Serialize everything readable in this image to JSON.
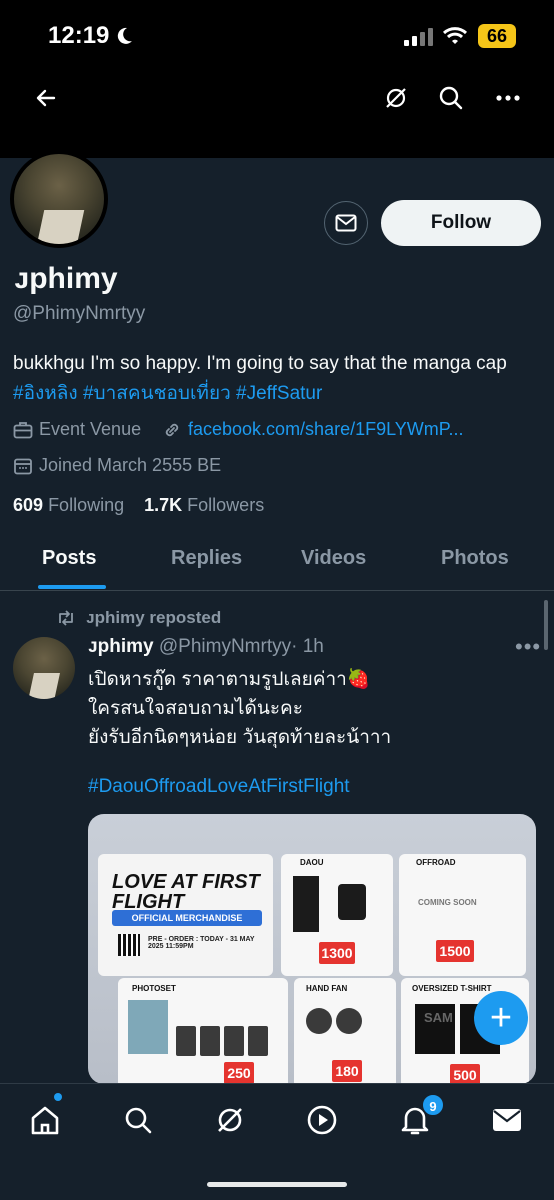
{
  "status_bar": {
    "time": "12:19",
    "battery": "66"
  },
  "profile": {
    "display_name": "ᴊphimy",
    "handle": "@PhimyNmrtyy",
    "bio_text": "bukkhgu I'm so happy. I'm going to say that the manga cap ",
    "bio_tags": [
      "#อิงหลิง",
      "#บาสคนชอบเที่ยว",
      "#JeffSatur"
    ],
    "category": "Event Venue",
    "link": "facebook.com/share/1F9LYWmP...",
    "joined": "Joined March 2555 BE",
    "following_count": "609",
    "following_label": "Following",
    "followers_count": "1.7K",
    "followers_label": "Followers",
    "follow_label": "Follow"
  },
  "tabs": [
    "Posts",
    "Replies",
    "Videos",
    "Photos"
  ],
  "post": {
    "repost_label": "ᴊphimy reposted",
    "author": "ᴊphimy",
    "handle": "@PhimyNmrtyy",
    "time": "· 1h",
    "more": "•••",
    "text": "เปิดหารกู๊ด ราคาตามรูปเลยค่าา🍓\nใครสนใจสอบถามได้นะคะ\nยังรับอีกนิดๆหน่อย วันสุดท้ายละน้าาา",
    "hashtag": "#DaouOffroadLoveAtFirstFlight"
  },
  "promo": {
    "title": "LOVE AT FIRST FLIGHT",
    "subtitle": "OFFICIAL MERCHANDISE",
    "preorder": "PRE - ORDER : TODAY - 31 MAY 2025 11:59PM",
    "card1": "DAOU",
    "card1_price": "1300",
    "card2": "OFFROAD",
    "card2_note": "COMING SOON",
    "card2_price": "1500",
    "card3": "PHOTOSET",
    "card3_price": "250",
    "card4": "HAND FAN",
    "card4_price": "180",
    "card5": "OVERSIZED T-SHIRT",
    "card5_price": "500",
    "tshirt_text": "SAM"
  },
  "bottom_nav": {
    "notifications_count": "9"
  },
  "colors": {
    "accent": "#1d9bf0",
    "background": "#15202b",
    "muted": "#8b98a5",
    "price_red": "#e5342f"
  }
}
